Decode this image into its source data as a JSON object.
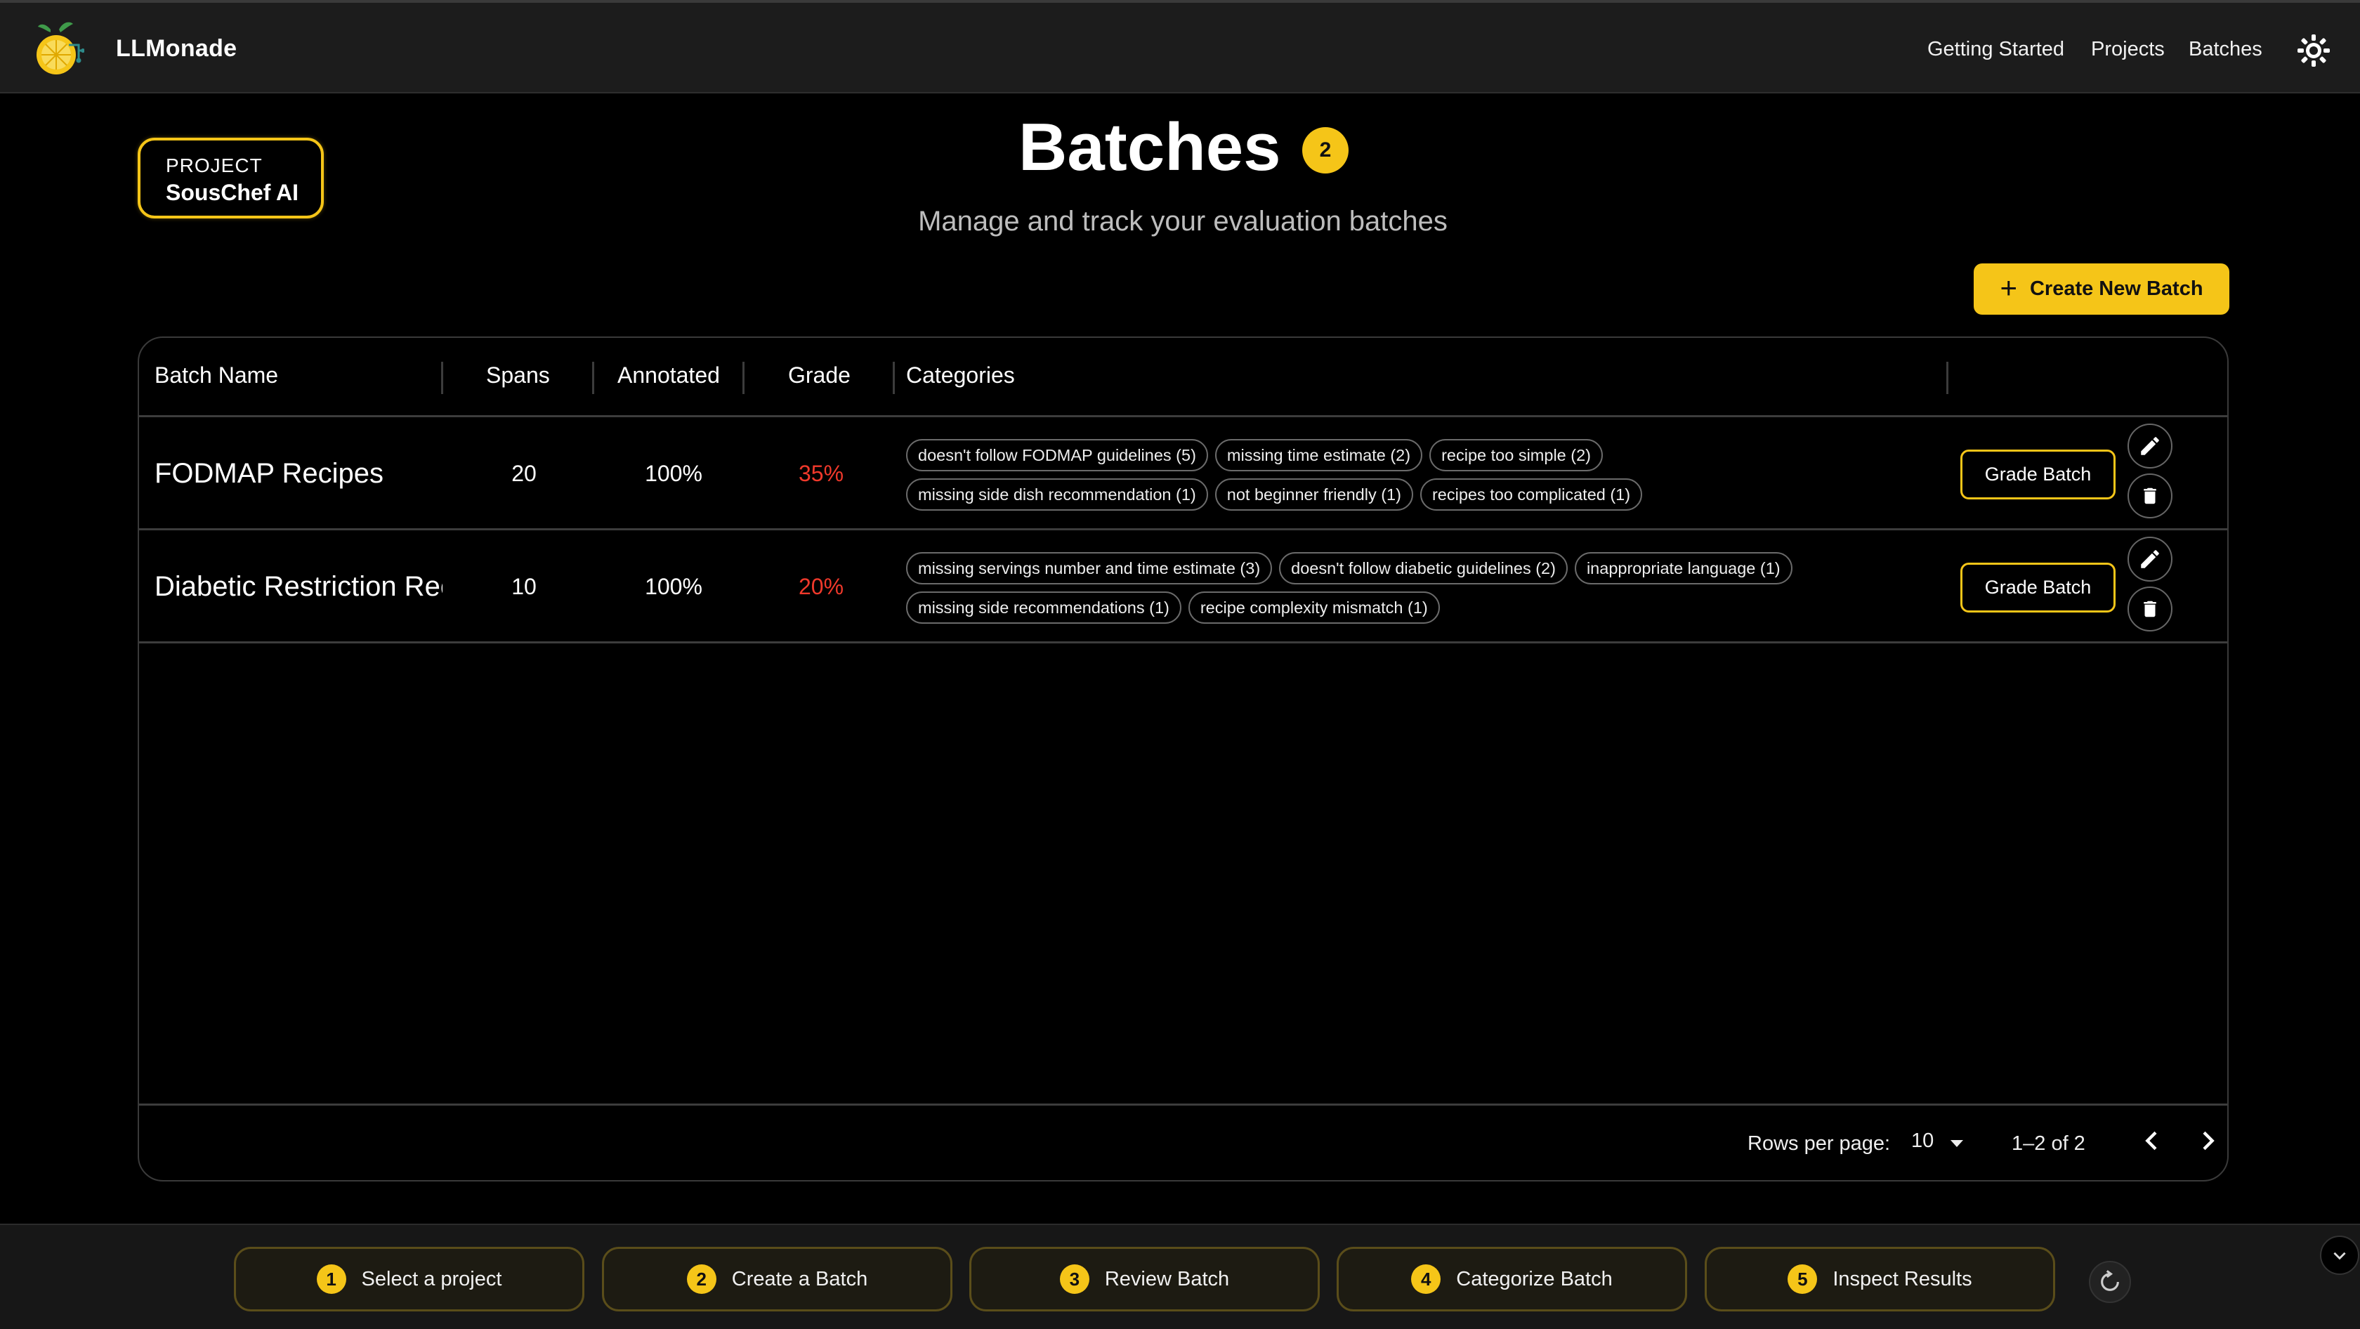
{
  "app": {
    "name": "LLMonade"
  },
  "nav": {
    "links": [
      "Getting Started",
      "Projects",
      "Batches"
    ]
  },
  "project": {
    "label": "PROJECT",
    "name": "SousChef AI"
  },
  "header": {
    "title": "Batches",
    "count": "2",
    "subtitle": "Manage and track your evaluation batches",
    "create_label": "Create New Batch"
  },
  "table": {
    "columns": [
      "Batch Name",
      "Spans",
      "Annotated",
      "Grade",
      "Categories"
    ],
    "rows": [
      {
        "name": "FODMAP Recipes",
        "spans": "20",
        "annotated": "100%",
        "grade": "35%",
        "category_lines": [
          [
            "doesn't follow FODMAP guidelines (5)",
            "missing time estimate (2)",
            "recipe too simple (2)"
          ],
          [
            "missing side dish recommendation (1)",
            "not beginner friendly (1)",
            "recipes too complicated (1)"
          ]
        ],
        "action_label": "Grade Batch"
      },
      {
        "name": "Diabetic Restriction Recipes",
        "spans": "10",
        "annotated": "100%",
        "grade": "20%",
        "category_lines": [
          [
            "missing servings number and time estimate (3)",
            "doesn't follow diabetic guidelines (2)",
            "inappropriate language (1)"
          ],
          [
            "missing side recommendations (1)",
            "recipe complexity mismatch (1)"
          ]
        ],
        "action_label": "Grade Batch"
      }
    ],
    "footer": {
      "rows_per_page_label": "Rows per page:",
      "rows_per_page": "10",
      "range": "1–2 of 2"
    }
  },
  "workflow": {
    "steps": [
      {
        "num": "1",
        "label": "Select a project"
      },
      {
        "num": "2",
        "label": "Create a Batch"
      },
      {
        "num": "3",
        "label": "Review Batch"
      },
      {
        "num": "4",
        "label": "Categorize Batch"
      },
      {
        "num": "5",
        "label": "Inspect Results"
      }
    ]
  },
  "colors": {
    "accent": "#f5c518",
    "grade_low": "#f0392b",
    "background": "#000000",
    "nav_bg": "#1c1c1c"
  },
  "icons": [
    "lemon-logo-icon",
    "sun-icon",
    "plus-icon",
    "pencil-icon",
    "trash-icon",
    "chevron-left-icon",
    "chevron-right-icon",
    "caret-down-icon",
    "refresh-icon",
    "chevron-down-icon"
  ]
}
